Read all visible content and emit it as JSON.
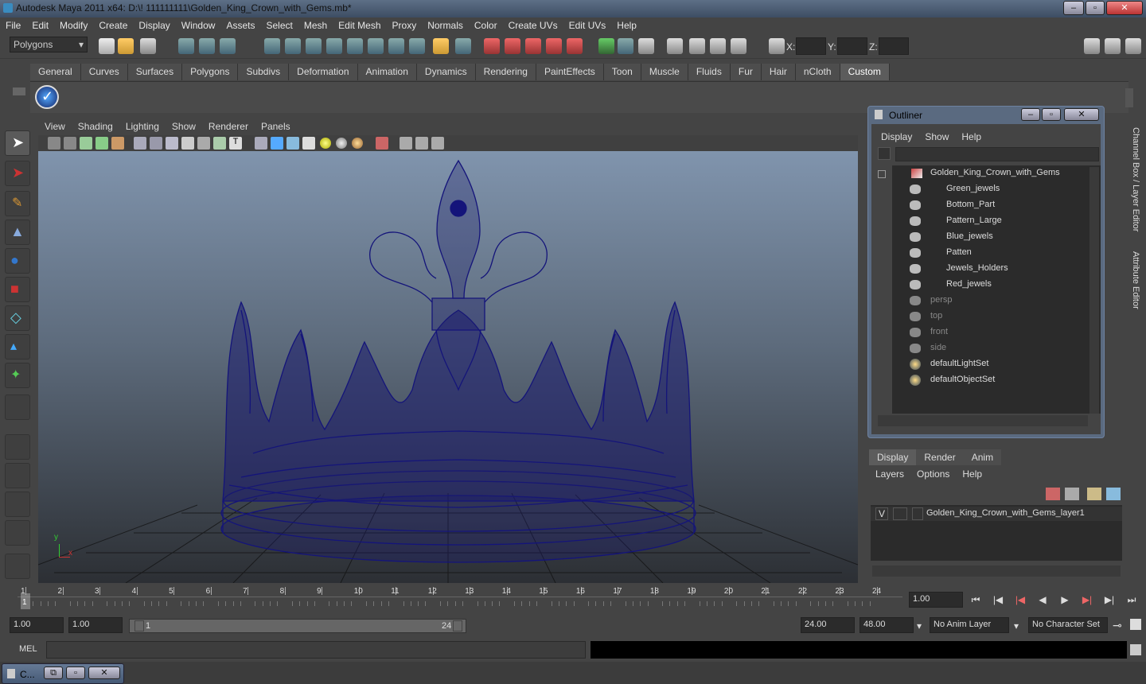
{
  "window": {
    "title": "Autodesk Maya 2011 x64: D:\\! 111111111\\Golden_King_Crown_with_Gems.mb*"
  },
  "menu": [
    "File",
    "Edit",
    "Modify",
    "Create",
    "Display",
    "Window",
    "Assets",
    "Select",
    "Mesh",
    "Edit Mesh",
    "Proxy",
    "Normals",
    "Color",
    "Create UVs",
    "Edit UVs",
    "Help"
  ],
  "status": {
    "mode": "Polygons",
    "x_label": "X:",
    "y_label": "Y:",
    "z_label": "Z:"
  },
  "shelf_tabs": [
    "General",
    "Curves",
    "Surfaces",
    "Polygons",
    "Subdivs",
    "Deformation",
    "Animation",
    "Dynamics",
    "Rendering",
    "PaintEffects",
    "Toon",
    "Muscle",
    "Fluids",
    "Fur",
    "Hair",
    "nCloth",
    "Custom"
  ],
  "shelf_active": "Custom",
  "panel_menu": [
    "View",
    "Shading",
    "Lighting",
    "Show",
    "Renderer",
    "Panels"
  ],
  "viewport": {
    "axis_x": "x",
    "axis_y": "y",
    "wire_color": "#14147a"
  },
  "outliner": {
    "title": "Outliner",
    "menu": [
      "Display",
      "Show",
      "Help"
    ],
    "items": [
      {
        "label": "Golden_King_Crown_with_Gems",
        "type": "group"
      },
      {
        "label": "Green_jewels",
        "type": "mesh"
      },
      {
        "label": "Bottom_Part",
        "type": "mesh"
      },
      {
        "label": "Pattern_Large",
        "type": "mesh"
      },
      {
        "label": "Blue_jewels",
        "type": "mesh"
      },
      {
        "label": "Patten",
        "type": "mesh"
      },
      {
        "label": "Jewels_Holders",
        "type": "mesh"
      },
      {
        "label": "Red_jewels",
        "type": "mesh"
      },
      {
        "label": "persp",
        "type": "camera"
      },
      {
        "label": "top",
        "type": "camera"
      },
      {
        "label": "front",
        "type": "camera"
      },
      {
        "label": "side",
        "type": "camera"
      },
      {
        "label": "defaultLightSet",
        "type": "set"
      },
      {
        "label": "defaultObjectSet",
        "type": "set"
      }
    ]
  },
  "side_tabs": {
    "channel": "Channel Box / Layer Editor",
    "attr": "Attribute Editor"
  },
  "layer_editor": {
    "tabs": [
      "Display",
      "Render",
      "Anim"
    ],
    "menu": [
      "Layers",
      "Options",
      "Help"
    ],
    "layer": {
      "visible": "V",
      "name": "Golden_King_Crown_with_Gems_layer1"
    }
  },
  "timeline": {
    "ticks": [
      "1",
      "2",
      "3",
      "4",
      "5",
      "6",
      "7",
      "8",
      "9",
      "10",
      "11",
      "12",
      "13",
      "14",
      "15",
      "16",
      "17",
      "18",
      "19",
      "20",
      "21",
      "22",
      "23",
      "24"
    ],
    "current_frame": "1",
    "current_time_field": "1.00"
  },
  "range": {
    "start": "1.00",
    "playback_start": "1.00",
    "slider_start": "1",
    "slider_end": "24",
    "playback_end": "24.00",
    "end": "48.00",
    "anim_layer": "No Anim Layer",
    "character_set": "No Character Set"
  },
  "mel": {
    "label": "MEL"
  },
  "taskbar": {
    "item": "C..."
  }
}
